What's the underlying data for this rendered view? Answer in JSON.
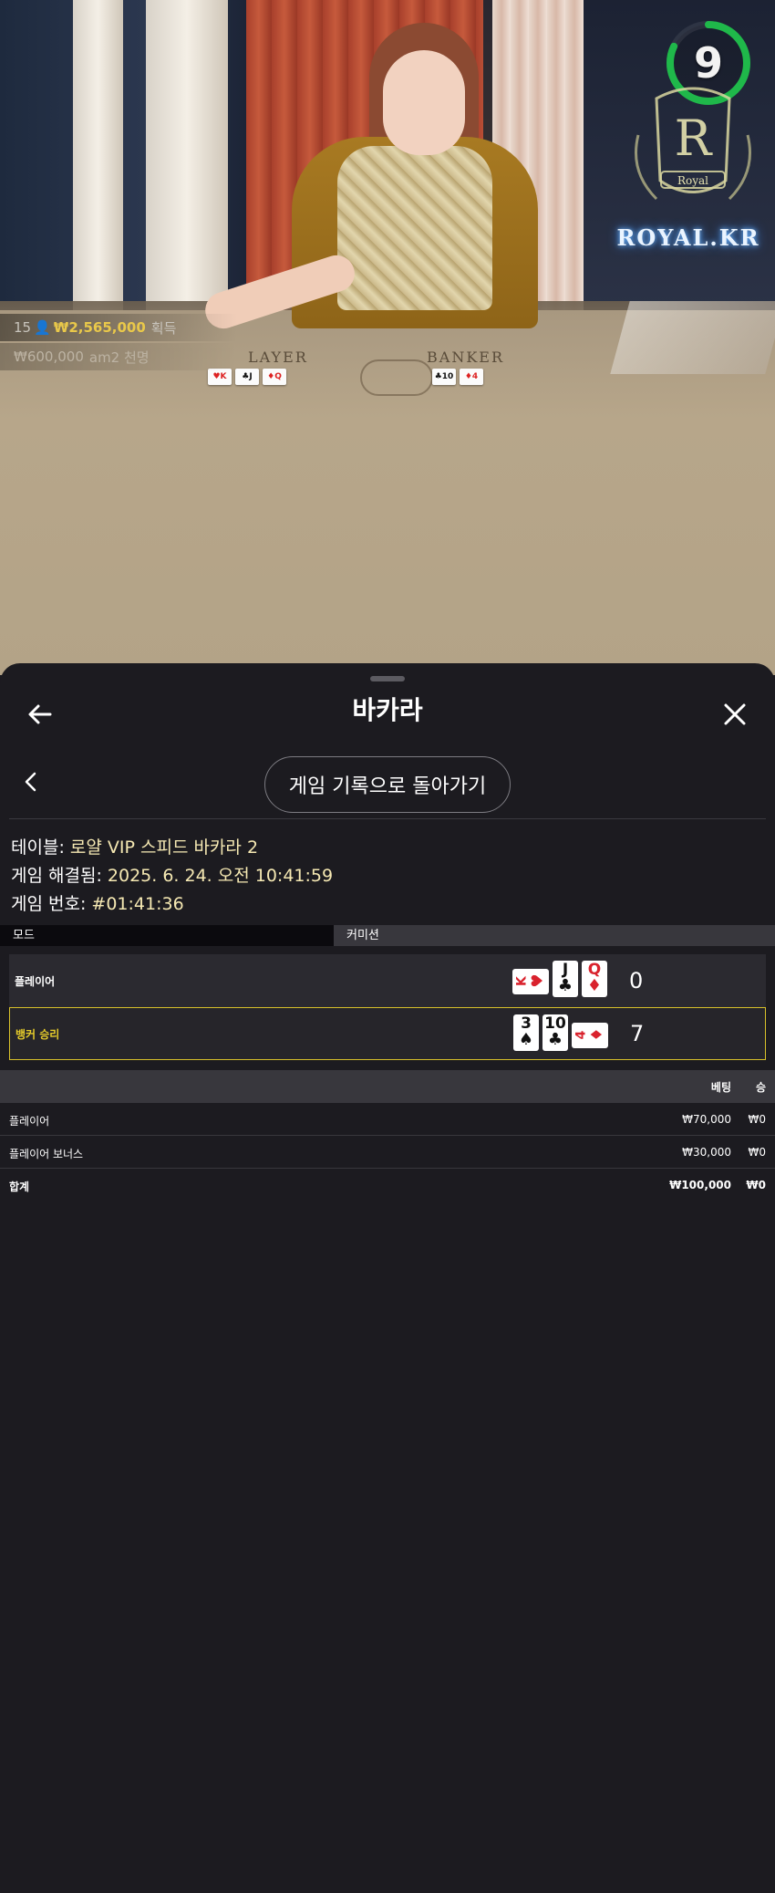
{
  "video": {
    "timer": "9",
    "timer_progress": 0.82,
    "brand": "ROYAL.KR",
    "logo_text": "Royal",
    "felt_left": "LAYER",
    "felt_right": "BANKER",
    "ticker": [
      {
        "count": "15",
        "amount": "₩2,565,000",
        "suffix": "획득"
      },
      {
        "count": "",
        "amount": "₩600,000",
        "suffix": "am2 천명"
      }
    ]
  },
  "sheet": {
    "title": "바카라",
    "back_label": "게임 기록으로 돌아가기",
    "info": {
      "table_label": "테이블:",
      "table_value": "로얄 VIP 스피드 바카라 2",
      "resolved_label": "게임 해결됨:",
      "resolved_value": "2025. 6. 24. 오전 10:41:59",
      "number_label": "게임 번호:",
      "number_value": "#01:41:36"
    },
    "mode": {
      "left": "모드",
      "right": "커미션"
    },
    "results": [
      {
        "label": "플레이어",
        "score": "0",
        "cards": [
          {
            "rank": "K",
            "suit": "♥",
            "color": "red",
            "side": true
          },
          {
            "rank": "J",
            "suit": "♣",
            "color": "black",
            "side": false
          },
          {
            "rank": "Q",
            "suit": "♦",
            "color": "red",
            "side": false
          }
        ]
      },
      {
        "label": "뱅커 승리",
        "score": "7",
        "cards": [
          {
            "rank": "3",
            "suit": "♠",
            "color": "black",
            "side": false
          },
          {
            "rank": "10",
            "suit": "♣",
            "color": "black",
            "side": false
          },
          {
            "rank": "4",
            "suit": "♦",
            "color": "red",
            "side": true
          }
        ]
      }
    ],
    "bets": {
      "headers": {
        "bet": "베팅",
        "win": "승"
      },
      "rows": [
        {
          "name": "플레이어",
          "bet": "₩70,000",
          "win": "₩0"
        },
        {
          "name": "플레이어 보너스",
          "bet": "₩30,000",
          "win": "₩0"
        }
      ],
      "total": {
        "name": "합계",
        "bet": "₩100,000",
        "win": "₩0"
      }
    }
  },
  "colors": {
    "accent_gold": "#e6cc2a",
    "timer_green": "#1fb84a",
    "sheet_bg": "#1c1b20"
  }
}
